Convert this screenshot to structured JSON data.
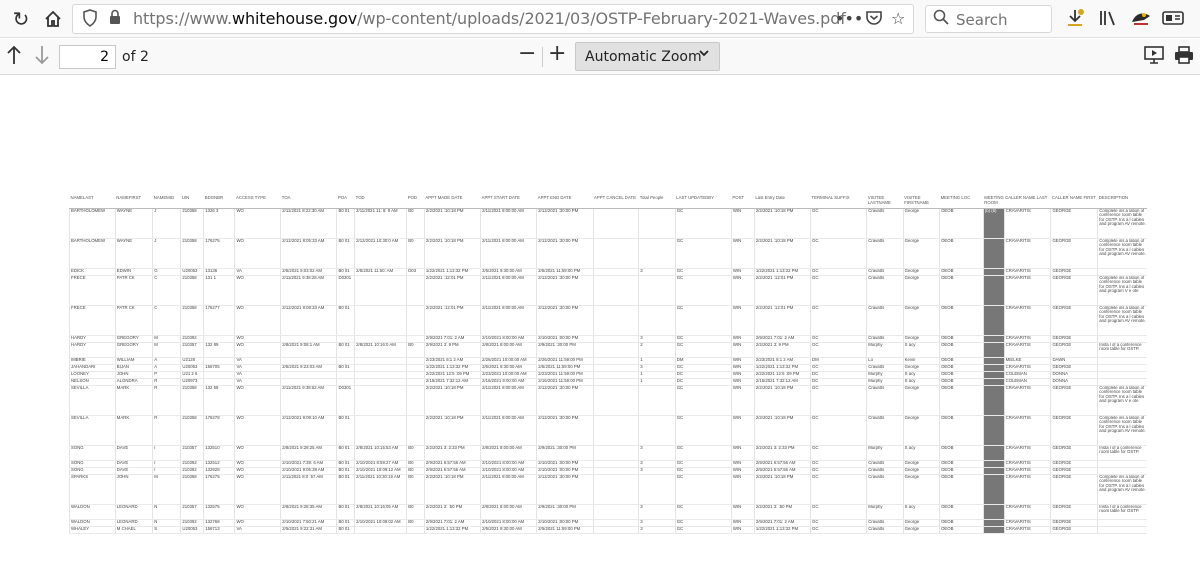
{
  "browser": {
    "url_prefix": "https://www.",
    "url_domain": "whitehouse.gov",
    "url_path": "/wp-content/uploads/2021/03/OSTP-February-2021-Waves.pdf",
    "search_placeholder": "Search",
    "icons": [
      "reload-icon",
      "home-icon",
      "shield-icon",
      "lock-icon",
      "more-icon",
      "pocket-icon",
      "bookmark-star-icon",
      "search-icon",
      "download-icon",
      "library-icon",
      "extension-icon",
      "account-icon"
    ]
  },
  "pdf_toolbar": {
    "page_input_value": "2",
    "page_count_label": "of 2",
    "zoom_label": "Automatic Zoom",
    "zoom_out": "−",
    "zoom_in": "+"
  },
  "table": {
    "headers": [
      "NAMELAST",
      "NAMEFIRST",
      "NAMEMID",
      "UIN",
      "BDGNBR",
      "ACCESS TYPE",
      "TOA",
      "POA",
      "TOD",
      "POD",
      "APPT MADE DATE",
      "APPT START DATE",
      "APPT END DATE",
      "APPT CANCEL DATE",
      "Total People",
      "LAST UPDATEDBY",
      "POST",
      "Last Entry Date",
      "TERMINAL SUFFIX",
      "VISITEE LASTNAME",
      "VISITEE FIRSTNAME",
      "MEETING LOC",
      "MEETING ROOM",
      "CALLER NAME LAST",
      "CALLER NAME FIRST",
      "DESCRIPTION"
    ],
    "rows": [
      [
        "BARTHOLOMEW",
        "WAYNE",
        "J",
        "210358",
        "1326 3",
        "WO",
        "2/11/2021 8:22:30 AM",
        "B0 01",
        "2/11/2021 11: 8: 8 AM",
        "B0",
        "2/2/2021 :10:18 PM",
        "2/11/2021 8:00:00 AM",
        "2/12/2021 :30:00 PM",
        "",
        "",
        "GC",
        "WIN",
        "2/2/2021 :10:18 PM",
        "GC",
        "Cravatts",
        "George",
        "OEOB",
        "(b) (6)",
        "CRAVARITIS",
        "GEORGE",
        "Complete ins a lation of conference room table for OSTP. Ins a l cables and program AV remote."
      ],
      [
        "BARTHOLOMEW",
        "WAYNE",
        "J",
        "210358",
        "176275",
        "WO",
        "2/12/2021 8:05:33 AM",
        "B0 01",
        "2/12/2021 10:30:0 AM",
        "B0",
        "2/2/2021 :10:18 PM",
        "2/11/2021 8:00:00 AM",
        "2/12/2021 :30:00 PM",
        "",
        "",
        "GC",
        "WIN",
        "2/2/2021 :10:18 PM",
        "GC",
        "Cravatts",
        "George",
        "OEOB",
        "",
        "CRAVARITIS",
        "GEORGE",
        "Complete ins a lation of conference room table for OSTP. Ins a l cables and program AV remote."
      ],
      [
        "EDICK",
        "EDWIN",
        "G",
        "U20053",
        "13136",
        "VA",
        "2/5/2021 9:03:02 AM",
        "B0 01",
        "2/5/2021 11:50: AM",
        "D03",
        "1/22/2021 1:13:32 PM",
        "2/5/2021 9:30:00 AM",
        "2/5/2021 11:59:00 PM",
        "",
        "3",
        "GC",
        "WIN",
        "1/22/2021 1:13:32 PM",
        "GC",
        "Cravatts",
        "George",
        "OEOB",
        "",
        "CRAVARITIS",
        "GEORGE",
        ""
      ],
      [
        "FRECE",
        "PATR CK",
        "C",
        "210358",
        "131 1",
        "WO",
        "2/11/2021 9:38:28 AM",
        "D0301",
        "",
        "",
        "2/2/2021 :12:01 PM",
        "2/11/2021 8:00:00 AM",
        "2/12/2021 :30:00 PM",
        "",
        "",
        "GC",
        "WIN",
        "2/2/2021 :12:01 PM",
        "GC",
        "Cravatts",
        "George",
        "OEOB",
        "",
        "CRAVARITIS",
        "GEORGE",
        "Complete ins a lation of conference room table for OSTP. Ins a l cables and program V e ote"
      ],
      [
        "FRECE",
        "PATR CK",
        "C",
        "210358",
        "176277",
        "WO",
        "2/12/2021 8:08:33 AM",
        "B0 01",
        "",
        "",
        "2/2/2021 :12:01 PM",
        "2/11/2021 8:00:00 AM",
        "2/12/2021 :30:00 PM",
        "",
        "",
        "GC",
        "WIN",
        "2/2/2021 :12:01 PM",
        "GC",
        "Cravatts",
        "George",
        "OEOB",
        "",
        "CRAVARITIS",
        "GEORGE",
        "Complete ins a lation of conference room table for OSTP. Ins a l cables and program AV remote."
      ],
      [
        "HARDY",
        "GREGORY",
        "M",
        "210392",
        "",
        "WO",
        "",
        "",
        "",
        "",
        "2/9/2021 7:01: 2 AM",
        "2/10/2021 8:00:00 AM",
        "2/10/2021 :00:00 PM",
        "",
        "3",
        "GC",
        "WIN",
        "2/9/2021 7:01: 2 AM",
        "GC",
        "Cravatts",
        "George",
        "OEOB",
        "",
        "CRAVARITIS",
        "GEORGE",
        ""
      ],
      [
        "HARDY",
        "GREGORY",
        "M",
        "210357",
        "132 89",
        "WO",
        "2/8/2021 9:08:1 AM",
        "B0 01",
        "2/8/2021 10:16:0 AM",
        "B0",
        "2/9/2021 3: 9 PM",
        "2/8/2021 8:00:00 AM",
        "2/9/2021 :30:00 PM",
        "",
        "2",
        "GC",
        "WIN",
        "2/2/2021 3: 9 PM",
        "GC",
        "Murphy",
        "S acy",
        "OEOB",
        "",
        "CRAVARITIS",
        "GEORGE",
        "Insta l of a conference room table for OSTP."
      ],
      [
        "IMBRIE",
        "WILLIAM",
        "A",
        "U2128",
        "",
        "VA",
        "",
        "",
        "",
        "",
        "2/23/2021 8:1 2 AM",
        "2/26/2021 10:00:00 AM",
        "2/26/2021 11:59:00 PM",
        "",
        "1",
        "DM",
        "WIN",
        "2/23/2021 8:1 2 AM",
        "DM",
        "Lo",
        "Kevin",
        "OEOB",
        "",
        "MIELKE",
        "DAWN",
        ""
      ],
      [
        "JAHANDARI",
        "BIJAN",
        "A",
        "U20053",
        "156705",
        "VA",
        "2/5/2021 9:23:03 AM",
        "B0 01",
        "",
        "",
        "1/22/2021 1:13:32 PM",
        "2/5/2021 9:30:00 AM",
        "2/5/2021 11:59:00 PM",
        "",
        "3",
        "GC",
        "WIN",
        "1/22/2021 1:13:32 PM",
        "GC",
        "Cravatts",
        "George",
        "OEOB",
        "",
        "CRAVARITIS",
        "GEORGE",
        ""
      ],
      [
        "LOONEY",
        "JOHN",
        "P",
        "U21 2 6",
        "",
        "VA",
        "",
        "",
        "",
        "",
        "2/22/2021 12:5 :09 PM",
        "2/23/2021 10:00:00 AM",
        "2/23/2021 11:59:00 PM",
        "",
        "1",
        "DC",
        "WIN",
        "2/22/2021 12:5 :09 PM",
        "DC",
        "Murphy",
        "S acy",
        "OEOB",
        "",
        "COLEMAN",
        "DONNA",
        ""
      ],
      [
        "NELSON",
        "ALONDRA",
        "R",
        "U20973",
        "",
        "VA",
        "",
        "",
        "",
        "",
        "2/15/2021 7:32:12 AM",
        "2/16/2021 9:00:00 AM",
        "2/16/2021 11:59:00 PM",
        "",
        "1",
        "DC",
        "WIN",
        "2/15/2021 7:32:12 AM",
        "DC",
        "Murphy",
        "S acy",
        "OEOB",
        "",
        "COLEMAN",
        "DONNA",
        ""
      ],
      [
        "SEVILLA",
        "MARK",
        "R",
        "210358",
        "132 59",
        "WO",
        "2/11/2021 9:38:52 AM",
        "D0301",
        "",
        "",
        "2/2/2021 :10:18 PM",
        "2/11/2021 8:00:00 AM",
        "2/12/2021 :30:00 PM",
        "",
        "",
        "GC",
        "WIN",
        "2/2/2021 :10:18 PM",
        "GC",
        "Cravatts",
        "George",
        "OEOB",
        "",
        "CRAVARITIS",
        "GEORGE",
        "Complete ins a lation of conference room table for OSTP. Ins a l cables and program V e ote"
      ],
      [
        "SEVILLA",
        "MARK",
        "R",
        "210358",
        "176278",
        "WO",
        "2/12/2021 9:09:10 AM",
        "B0 01",
        "",
        "",
        "2/2/2021 :10:18 PM",
        "2/11/2021 8:00:00 AM",
        "2/12/2021 :30:00 PM",
        "",
        "",
        "GC",
        "WIN",
        "2/2/2021 :10:18 PM",
        "GC",
        "Cravatts",
        "George",
        "OEOB",
        "",
        "CRAVARITIS",
        "GEORGE",
        "Complete ins a lation of conference room table for OSTP. Ins a l cables and program AV remote."
      ],
      [
        "SONG",
        "DAVE",
        "I",
        "210357",
        "132510",
        "WO",
        "2/8/2021 9:28:25 AM",
        "B0 01",
        "2/8/2021 10:15:53 AM",
        "B0",
        "2/2/2021 3: 2:33 PM",
        "2/8/2021 8:00:00 AM",
        "2/9/2021 :30:00 PM",
        "",
        "3",
        "GC",
        "WIN",
        "2/2/2021 3: 2:33 PM",
        "GC",
        "Murphy",
        "S acy",
        "OEOB",
        "",
        "CRAVARITIS",
        "GEORGE",
        "Insta l of a conference room table for OSTP."
      ],
      [
        "SONG",
        "DAVE",
        "I",
        "210392",
        "132512",
        "WO",
        "2/10/2021 7:39: 6 AM",
        "B0 01",
        "2/10/2021 8:59:27 AM",
        "B0",
        "2/9/2021 6:57:56 AM",
        "2/10/2021 8:00:00 AM",
        "2/10/2021 :00:00 PM",
        "",
        "3",
        "GC",
        "WIN",
        "2/9/2021 6:57:56 AM",
        "GC",
        "Cravatts",
        "George",
        "OEOB",
        "",
        "CRAVARITIS",
        "GEORGE",
        ""
      ],
      [
        "SONG",
        "DAVE",
        "I",
        "210392",
        "132928",
        "WO",
        "2/10/2021 9:05:38 AM",
        "B0 01",
        "2/10/2021 10:09:12 AM",
        "B0",
        "2/9/2021 6:57:56 AM",
        "2/10/2021 8:00:00 AM",
        "2/10/2021 :00:00 PM",
        "",
        "3",
        "GC",
        "WIN",
        "2/9/2021 6:57:56 AM",
        "GC",
        "Cravatts",
        "George",
        "OEOB",
        "",
        "CRAVARITIS",
        "GEORGE",
        ""
      ],
      [
        "SPARKS",
        "JOHN",
        "M",
        "210358",
        "176275",
        "WO",
        "2/11/2021 8:0 :57 AM",
        "B0 01",
        "2/11/2021 10:30:19 AM",
        "B0",
        "2/2/2021 :10:18 PM",
        "2/11/2021 8:00:00 AM",
        "2/12/2021 :30:00 PM",
        "",
        "",
        "GC",
        "WIN",
        "2/2/2021 :10:18 PM",
        "GC",
        "Cravatts",
        "George",
        "OEOB",
        "",
        "CRAVARITIS",
        "GEORGE",
        "Complete ins a lation of conference room table for OSTP. Ins a l cables and program AV remote."
      ],
      [
        "WALDON",
        "LEONARD",
        "N",
        "210357",
        "132575",
        "WO",
        "2/8/2021 9:28:35 AM",
        "B0 01",
        "2/8/2021 10:15:05 AM",
        "B0",
        "2/2/2021 3: :50 PM",
        "2/8/2021 8:00:00 AM",
        "2/9/2021 :30:00 PM",
        "",
        "3",
        "GC",
        "WIN",
        "2/2/2021 3: :50 PM",
        "GC",
        "Murphy",
        "S acy",
        "OEOB",
        "",
        "CRAVARITIS",
        "GEORGE",
        "Insta l of a conference room table for OSTP."
      ],
      [
        "WALDON",
        "LEONARD",
        "N",
        "210392",
        "132768",
        "WO",
        "2/10/2021 7:50:21 AM",
        "B0 01",
        "2/10/2021 10:09:02 AM",
        "B0",
        "2/9/2021 7:01: 2 AM",
        "2/10/2021 8:00:00 AM",
        "2/10/2021 :00:00 PM",
        "",
        "3",
        "GC",
        "WIN",
        "2/9/2021 7:01: 2 AM",
        "GC",
        "Cravatts",
        "George",
        "OEOB",
        "",
        "CRAVARITIS",
        "GEORGE",
        ""
      ],
      [
        "WHALEY",
        "M CHAEL",
        "S",
        "U20053",
        "156713",
        "VA",
        "2/5/2021 9:22:31 AM",
        "B0 01",
        "",
        "",
        "1/22/2021 1:13:32 PM",
        "2/5/2021 9:30:00 AM",
        "2/5/2021 11:59:00 PM",
        "",
        "3",
        "GC",
        "WIN",
        "1/22/2021 1:13:32 PM",
        "GC",
        "Cravatts",
        "George",
        "OEOB",
        "",
        "CRAVARITIS",
        "GEORGE",
        ""
      ]
    ]
  }
}
